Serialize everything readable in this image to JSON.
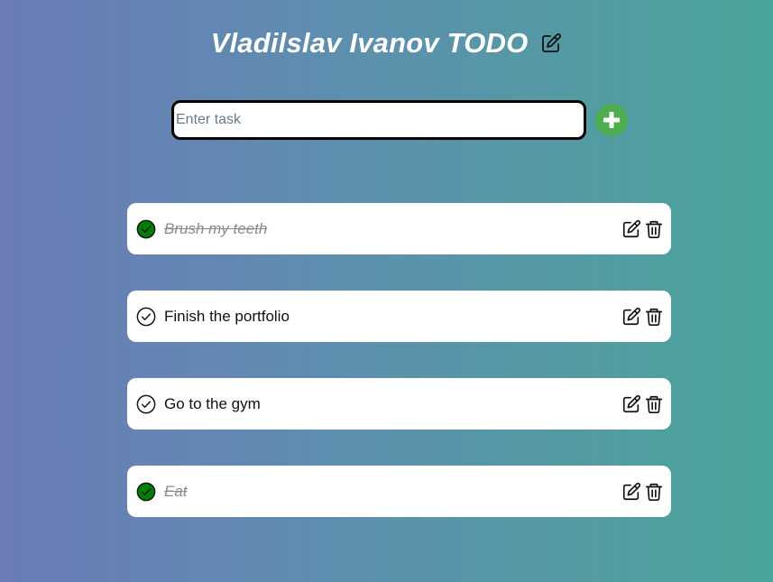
{
  "app": {
    "title": "Vladilslav Ivanov TODO"
  },
  "new_task": {
    "placeholder": "Enter task",
    "value": ""
  },
  "icons": {
    "title_edit": "edit-icon",
    "add": "plus-icon",
    "check": "check-circle-icon",
    "edit": "edit-icon",
    "delete": "trash-icon"
  },
  "colors": {
    "add_button": "#4cae50",
    "done_check": "#008000",
    "done_text": "#8a8a8a"
  },
  "tasks": [
    {
      "label": "Brush my teeth",
      "done": true
    },
    {
      "label": "Finish the portfolio",
      "done": false
    },
    {
      "label": "Go to the gym",
      "done": false
    },
    {
      "label": "Eat",
      "done": true
    }
  ]
}
